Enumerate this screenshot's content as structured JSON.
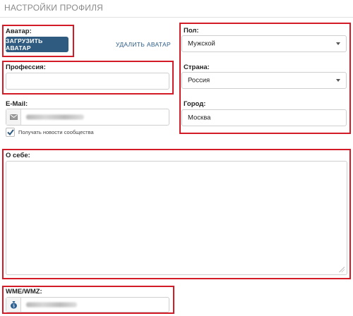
{
  "page": {
    "title": "НАСТРОЙКИ ПРОФИЛЯ"
  },
  "avatar": {
    "label": "Аватар:",
    "upload_button": "ЗАГРУЗИТЬ АВАТАР",
    "delete_link": "УДАЛИТЬ АВАТАР"
  },
  "profession": {
    "label": "Профессия:",
    "value": ""
  },
  "email": {
    "label": "E-Mail:",
    "icon": "envelope-icon",
    "newsletter_label": "Получать новости сообщества",
    "newsletter_checked": true
  },
  "gender": {
    "label": "Пол:",
    "selected": "Мужской"
  },
  "country": {
    "label": "Страна:",
    "selected": "Россия"
  },
  "city": {
    "label": "Город:",
    "value": "Москва"
  },
  "about": {
    "label": "О себе:",
    "value": ""
  },
  "wallet": {
    "label": "WME/WMZ:",
    "icon": "money-bag-icon"
  },
  "colors": {
    "highlight": "#d31b27",
    "button": "#2f5b80",
    "link": "#2b5c86"
  }
}
